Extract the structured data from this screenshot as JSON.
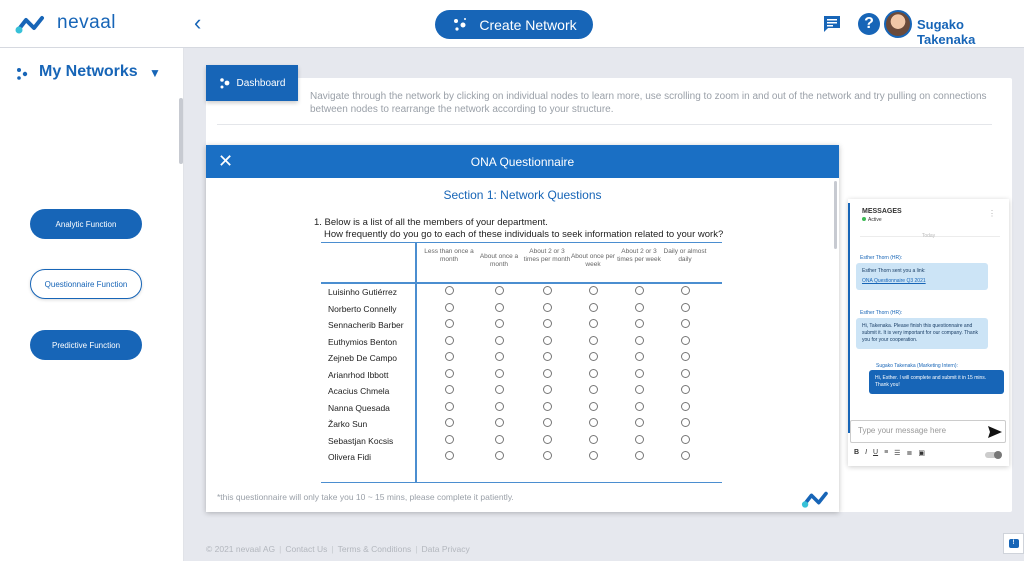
{
  "app": {
    "brand": "nevaal"
  },
  "header": {
    "back_icon": "chevron-left-icon",
    "create_label": "Create Network",
    "user_name": "Sugako Takenaka",
    "help_label": "?"
  },
  "sidebar": {
    "title": "My Networks",
    "buttons": [
      "Analytic Function",
      "Questionnaire Function",
      "Predictive Function"
    ]
  },
  "dashboard": {
    "button_label": "Dashboard",
    "instructions": "Navigate through the network by clicking on individual nodes to learn more, use scrolling to zoom in and out of the network and try pulling on connections between nodes to rearrange the network according to your structure."
  },
  "questionnaire": {
    "title": "ONA Questionnaire",
    "section": "Section 1: Network Questions",
    "question_line1": "1. Below is a list of all the members of your department.",
    "question_line2": "How frequently do you go to each of these individuals to seek information related to your work?",
    "columns": [
      "Less than once a month",
      "About once a month",
      "About 2 or 3 times per month",
      "About once per week",
      "About 2 or 3 times per week",
      "Daily or almost daily"
    ],
    "members": [
      "Luisinho Gutiérrez",
      "Norberto Connelly",
      "Sennacherib Barber",
      "Euthymios Benton",
      "Zejneb De Campo",
      "Arianrhod Ibbott",
      "Acacius Chmela",
      "Nanna Quesada",
      "Žarko Sun",
      "Sebastjan Kocsis",
      "Olivera Fidi"
    ],
    "footer_note": "*this questionnaire will only take you 10 ~ 15 mins, please complete it patiently."
  },
  "messages": {
    "title": "MESSAGES",
    "status": "Active",
    "today": "Today",
    "items": [
      {
        "sender": "Esther Thorn (HR):",
        "text": "Esther Thorn sent you a link:",
        "link": "ONA Questionnaire Q3 2021"
      },
      {
        "sender": "Esther Thorn (HR):",
        "text": "Hi, Takenaka. Please finish this questionnaire and submit it. It is very important for our company. Thank you for your cooperation."
      },
      {
        "sender": "Sugako Takenaka (Marketing Intern):",
        "text": "Hi, Esther. I will complete and submit it in 15 mins. Thank you!"
      }
    ],
    "input_placeholder": "Type your message here",
    "toolbar": [
      "B",
      "I",
      "U",
      "≡",
      "☰",
      "≣",
      "▣"
    ]
  },
  "footer": {
    "copyright": "© 2021 nevaal AG",
    "links": [
      "Contact Us",
      "Terms & Conditions",
      "Data Privacy"
    ]
  },
  "colors": {
    "primary": "#1765b7",
    "header_blue": "#1a6fc4",
    "bubble_in": "#cce4f6"
  }
}
